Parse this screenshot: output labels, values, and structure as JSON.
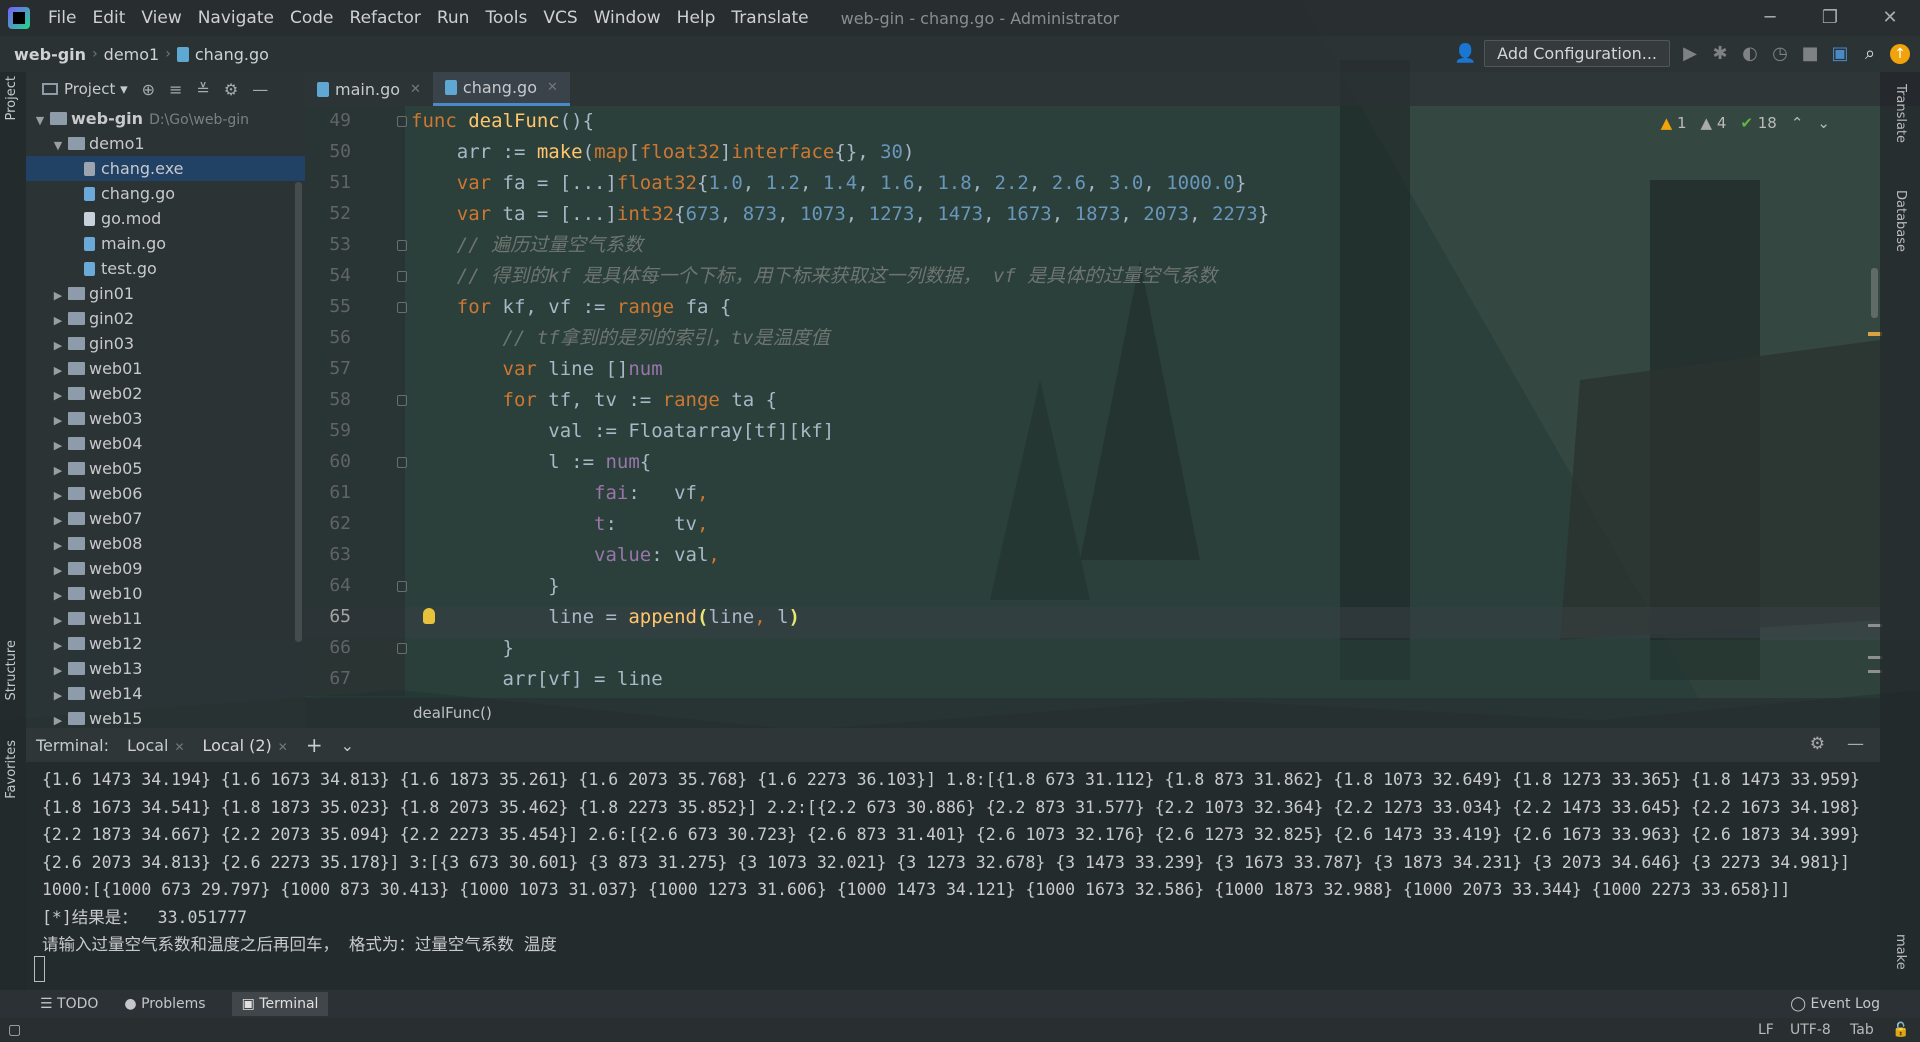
{
  "window": {
    "title": "web-gin - chang.go - Administrator",
    "menu": [
      "File",
      "Edit",
      "View",
      "Navigate",
      "Code",
      "Refactor",
      "Run",
      "Tools",
      "VCS",
      "Window",
      "Help",
      "Translate"
    ],
    "controls": [
      "─",
      "❐",
      "✕"
    ]
  },
  "navbar": {
    "breadcrumb": [
      "web-gin",
      "demo1",
      "chang.go"
    ],
    "add_config": "Add Configuration..."
  },
  "left_strip": {
    "project_label": "Project",
    "structure_label": "Structure",
    "favorites_label": "Favorites"
  },
  "project": {
    "title": "Project",
    "root": {
      "name": "web-gin",
      "path": "D:\\Go\\web-gin"
    },
    "items": [
      {
        "label": "demo1",
        "kind": "folder",
        "expanded": true,
        "depth": 1
      },
      {
        "label": "chang.exe",
        "kind": "exe",
        "depth": 2,
        "selected": true
      },
      {
        "label": "chang.go",
        "kind": "go",
        "depth": 2
      },
      {
        "label": "go.mod",
        "kind": "mod",
        "depth": 2
      },
      {
        "label": "main.go",
        "kind": "go",
        "depth": 2
      },
      {
        "label": "test.go",
        "kind": "go",
        "depth": 2
      },
      {
        "label": "gin01",
        "kind": "folder",
        "depth": 1
      },
      {
        "label": "gin02",
        "kind": "folder",
        "depth": 1
      },
      {
        "label": "gin03",
        "kind": "folder",
        "depth": 1
      },
      {
        "label": "web01",
        "kind": "folder",
        "depth": 1
      },
      {
        "label": "web02",
        "kind": "folder",
        "depth": 1
      },
      {
        "label": "web03",
        "kind": "folder",
        "depth": 1
      },
      {
        "label": "web04",
        "kind": "folder",
        "depth": 1
      },
      {
        "label": "web05",
        "kind": "folder",
        "depth": 1
      },
      {
        "label": "web06",
        "kind": "folder",
        "depth": 1
      },
      {
        "label": "web07",
        "kind": "folder",
        "depth": 1
      },
      {
        "label": "web08",
        "kind": "folder",
        "depth": 1
      },
      {
        "label": "web09",
        "kind": "folder",
        "depth": 1
      },
      {
        "label": "web10",
        "kind": "folder",
        "depth": 1
      },
      {
        "label": "web11",
        "kind": "folder",
        "depth": 1
      },
      {
        "label": "web12",
        "kind": "folder",
        "depth": 1
      },
      {
        "label": "web13",
        "kind": "folder",
        "depth": 1
      },
      {
        "label": "web14",
        "kind": "folder",
        "depth": 1
      },
      {
        "label": "web15",
        "kind": "folder",
        "depth": 1
      }
    ]
  },
  "editor": {
    "tabs": [
      {
        "label": "main.go"
      },
      {
        "label": "chang.go",
        "active": true
      }
    ],
    "inspections": {
      "errors": "1",
      "warnings": "4",
      "ok": "18"
    },
    "current_line": 65,
    "lines": [
      {
        "n": 49,
        "tokens": [
          [
            "kw",
            "func "
          ],
          [
            "fn",
            "dealFunc"
          ],
          [
            "pl",
            "(){"
          ]
        ]
      },
      {
        "n": 50,
        "tokens": [
          [
            "pl",
            "    arr := "
          ],
          [
            "fn",
            "make"
          ],
          [
            "pl",
            "("
          ],
          [
            "kw",
            "map"
          ],
          [
            "pl",
            "["
          ],
          [
            "ty",
            "float32"
          ],
          [
            "pl",
            "]"
          ],
          [
            "kw",
            "interface"
          ],
          [
            "pl",
            "{}, "
          ],
          [
            "num",
            "30"
          ],
          [
            "pl",
            ")"
          ]
        ]
      },
      {
        "n": 51,
        "tokens": [
          [
            "pl",
            "    "
          ],
          [
            "kw",
            "var "
          ],
          [
            "pl",
            "fa = [...]"
          ],
          [
            "ty",
            "float32"
          ],
          [
            "pl",
            "{"
          ],
          [
            "num",
            "1.0"
          ],
          [
            "pl",
            ", "
          ],
          [
            "num",
            "1.2"
          ],
          [
            "pl",
            ", "
          ],
          [
            "num",
            "1.4"
          ],
          [
            "pl",
            ", "
          ],
          [
            "num",
            "1.6"
          ],
          [
            "pl",
            ", "
          ],
          [
            "num",
            "1.8"
          ],
          [
            "pl",
            ", "
          ],
          [
            "num",
            "2.2"
          ],
          [
            "pl",
            ", "
          ],
          [
            "num",
            "2.6"
          ],
          [
            "pl",
            ", "
          ],
          [
            "num",
            "3.0"
          ],
          [
            "pl",
            ", "
          ],
          [
            "num",
            "1000.0"
          ],
          [
            "pl",
            "}"
          ]
        ]
      },
      {
        "n": 52,
        "tokens": [
          [
            "pl",
            "    "
          ],
          [
            "kw",
            "var "
          ],
          [
            "pl",
            "ta = [...]"
          ],
          [
            "ty",
            "int32"
          ],
          [
            "pl",
            "{"
          ],
          [
            "num",
            "673"
          ],
          [
            "pl",
            ", "
          ],
          [
            "num",
            "873"
          ],
          [
            "pl",
            ", "
          ],
          [
            "num",
            "1073"
          ],
          [
            "pl",
            ", "
          ],
          [
            "num",
            "1273"
          ],
          [
            "pl",
            ", "
          ],
          [
            "num",
            "1473"
          ],
          [
            "pl",
            ", "
          ],
          [
            "num",
            "1673"
          ],
          [
            "pl",
            ", "
          ],
          [
            "num",
            "1873"
          ],
          [
            "pl",
            ", "
          ],
          [
            "num",
            "2073"
          ],
          [
            "pl",
            ", "
          ],
          [
            "num",
            "2273"
          ],
          [
            "pl",
            "}"
          ]
        ]
      },
      {
        "n": 53,
        "tokens": [
          [
            "cm",
            "    // 遍历过量空气系数"
          ]
        ]
      },
      {
        "n": 54,
        "tokens": [
          [
            "cm",
            "    // 得到的kf 是具体每一个下标，用下标来获取这一列数据， vf 是具体的过量空气系数"
          ]
        ]
      },
      {
        "n": 55,
        "tokens": [
          [
            "pl",
            "    "
          ],
          [
            "kw",
            "for "
          ],
          [
            "pl",
            "kf, vf := "
          ],
          [
            "kw",
            "range "
          ],
          [
            "pl",
            "fa {"
          ]
        ]
      },
      {
        "n": 56,
        "tokens": [
          [
            "cm",
            "        // tf拿到的是列的索引，tv是温度值"
          ]
        ]
      },
      {
        "n": 57,
        "tokens": [
          [
            "pl",
            "        "
          ],
          [
            "kw",
            "var "
          ],
          [
            "pl",
            "line []"
          ],
          [
            "id",
            "num"
          ]
        ]
      },
      {
        "n": 58,
        "tokens": [
          [
            "pl",
            "        "
          ],
          [
            "kw",
            "for "
          ],
          [
            "pl",
            "tf, tv := "
          ],
          [
            "kw",
            "range "
          ],
          [
            "pl",
            "ta {"
          ]
        ]
      },
      {
        "n": 59,
        "tokens": [
          [
            "pl",
            "            val := Floatarray[tf][kf]"
          ]
        ]
      },
      {
        "n": 60,
        "tokens": [
          [
            "pl",
            "            l := "
          ],
          [
            "id",
            "num"
          ],
          [
            "pl",
            "{"
          ]
        ]
      },
      {
        "n": 61,
        "tokens": [
          [
            "id",
            "                fai"
          ],
          [
            "pl",
            ":   vf"
          ],
          [
            "kw",
            ","
          ]
        ]
      },
      {
        "n": 62,
        "tokens": [
          [
            "id",
            "                t"
          ],
          [
            "pl",
            ":     tv"
          ],
          [
            "kw",
            ","
          ]
        ]
      },
      {
        "n": 63,
        "tokens": [
          [
            "id",
            "                value"
          ],
          [
            "pl",
            ": val"
          ],
          [
            "kw",
            ","
          ]
        ]
      },
      {
        "n": 64,
        "tokens": [
          [
            "pl",
            "            }"
          ]
        ]
      },
      {
        "n": 65,
        "tokens": [
          [
            "pl",
            "            line = "
          ],
          [
            "fn",
            "append"
          ],
          [
            "paren",
            "("
          ],
          [
            "pl",
            "line"
          ],
          [
            "kw",
            ", "
          ],
          [
            "pl",
            "l"
          ],
          [
            "paren",
            ")"
          ]
        ]
      },
      {
        "n": 66,
        "tokens": [
          [
            "pl",
            "        }"
          ]
        ]
      },
      {
        "n": 67,
        "tokens": [
          [
            "pl",
            "        arr[vf] = line"
          ]
        ]
      }
    ],
    "breadcrumb": "dealFunc()"
  },
  "right_strip": {
    "translate_label": "Translate",
    "database_label": "Database",
    "make_label": "make"
  },
  "terminal": {
    "label": "Terminal:",
    "tabs": [
      "Local",
      "Local (2)"
    ],
    "lines": [
      "{1.6 1473 34.194} {1.6 1673 34.813} {1.6 1873 35.261} {1.6 2073 35.768} {1.6 2273 36.103}] 1.8:[{1.8 673 31.112} {1.8 873 31.862} {1.8 1073 32.649} {1.8 1273 33.365} {1.8 1473 33.959}",
      "{1.8 1673 34.541} {1.8 1873 35.023} {1.8 2073 35.462} {1.8 2273 35.852}] 2.2:[{2.2 673 30.886} {2.2 873 31.577} {2.2 1073 32.364} {2.2 1273 33.034} {2.2 1473 33.645} {2.2 1673 34.198}",
      "{2.2 1873 34.667} {2.2 2073 35.094} {2.2 2273 35.454}] 2.6:[{2.6 673 30.723} {2.6 873 31.401} {2.6 1073 32.176} {2.6 1273 32.825} {2.6 1473 33.419} {2.6 1673 33.963} {2.6 1873 34.399}",
      "{2.6 2073 34.813} {2.6 2273 35.178}] 3:[{3 673 30.601} {3 873 31.275} {3 1073 32.021} {3 1273 32.678} {3 1473 33.239} {3 1673 33.787} {3 1873 34.231} {3 2073 34.646} {3 2273 34.981}]",
      "1000:[{1000 673 29.797} {1000 873 30.413} {1000 1073 31.037} {1000 1273 31.606} {1000 1473 34.121} {1000 1673 32.586} {1000 1873 32.988} {1000 2073 33.344} {1000 2273 33.658}]]",
      "[*]结果是：  33.051777",
      "请输入过量空气系数和温度之后再回车， 格式为：过量空气系数 温度"
    ]
  },
  "toolwindows": {
    "todo": "TODO",
    "problems": "Problems",
    "terminal": "Terminal",
    "event_log": "Event Log"
  },
  "status": {
    "line_sep": "LF",
    "encoding": "UTF-8",
    "indent": "Tab"
  },
  "colors": {
    "accent": "#4a88c7",
    "keyword": "#cc7832",
    "function": "#ffc66d",
    "number": "#6897bb",
    "warning": "#f0a30a"
  }
}
